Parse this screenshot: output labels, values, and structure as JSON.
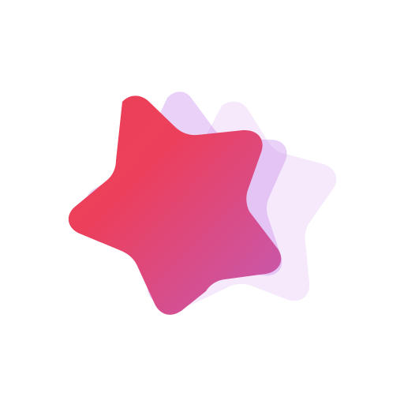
{
  "logo": {
    "name": "stacked-star-logo",
    "layers": [
      {
        "name": "back-star-layer",
        "color": "#D9A6F0",
        "opacity": 0.25
      },
      {
        "name": "middle-star-layer",
        "color": "#C98BEA",
        "opacity": 0.4
      },
      {
        "name": "front-star-layer",
        "gradient": [
          "#EB4257",
          "#EC3F5C",
          "#C45BB5"
        ]
      }
    ]
  }
}
